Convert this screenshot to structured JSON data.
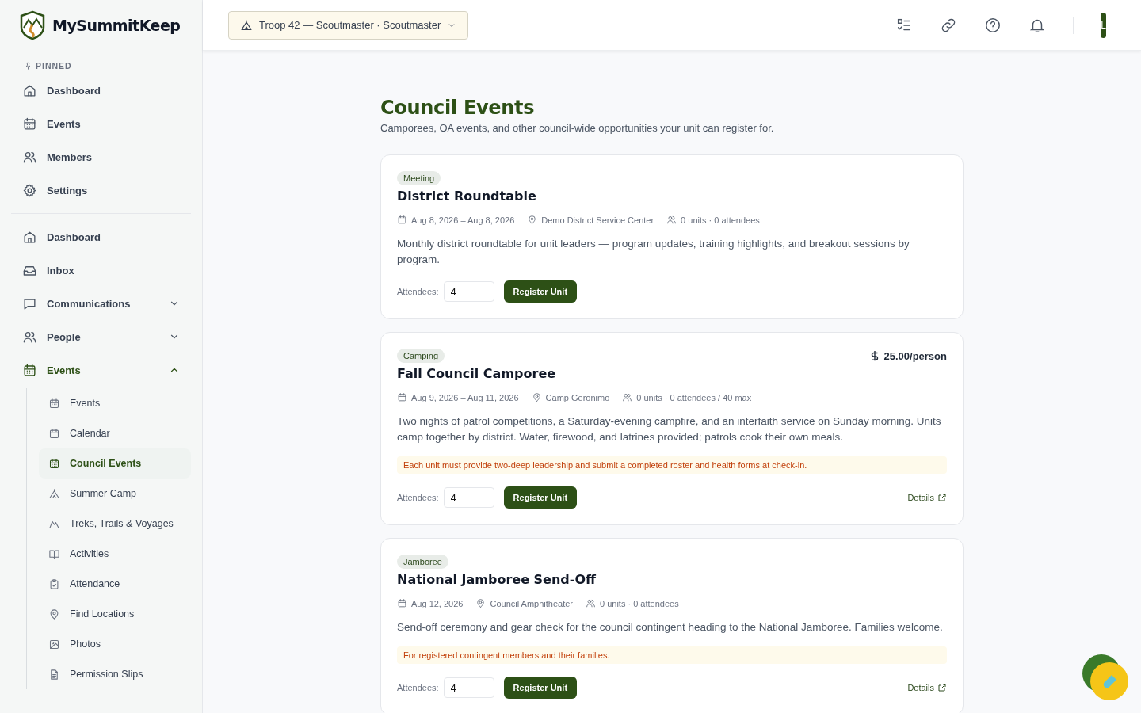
{
  "app": {
    "name": "MySummitKeep"
  },
  "unit_selector": {
    "label": "Troop 42 — Scoutmaster · Scoutmaster"
  },
  "account": {
    "initial": "L"
  },
  "sidebar": {
    "pinned_heading": "PINNED",
    "pinned": [
      {
        "label": "Dashboard",
        "kind": "home"
      },
      {
        "label": "Events",
        "kind": "calendar"
      },
      {
        "label": "Members",
        "kind": "people"
      },
      {
        "label": "Settings",
        "kind": "gear"
      }
    ],
    "nav": [
      {
        "label": "Dashboard",
        "kind": "home"
      },
      {
        "label": "Inbox",
        "kind": "inbox"
      },
      {
        "label": "Communications",
        "kind": "chat",
        "expanded": false
      },
      {
        "label": "People",
        "kind": "people",
        "expanded": false
      },
      {
        "label": "Events",
        "kind": "calendar",
        "expanded": true,
        "children": [
          {
            "label": "Events",
            "kind": "calendar",
            "selected": false
          },
          {
            "label": "Calendar",
            "kind": "calendar-blank",
            "selected": false
          },
          {
            "label": "Council Events",
            "kind": "calendar",
            "selected": true
          },
          {
            "label": "Summer Camp",
            "kind": "tent",
            "selected": false
          },
          {
            "label": "Treks, Trails & Voyages",
            "kind": "mountain",
            "selected": false
          },
          {
            "label": "Activities",
            "kind": "book",
            "selected": false
          },
          {
            "label": "Attendance",
            "kind": "clipboard",
            "selected": false
          },
          {
            "label": "Find Locations",
            "kind": "pin",
            "selected": false
          },
          {
            "label": "Photos",
            "kind": "image",
            "selected": false
          },
          {
            "label": "Permission Slips",
            "kind": "doc",
            "selected": false
          }
        ]
      }
    ]
  },
  "page": {
    "title": "Council Events",
    "subtitle": "Camporees, OA events, and other council-wide opportunities your unit can register for."
  },
  "events": [
    {
      "category": "Meeting",
      "title": "District Roundtable",
      "dates": "Aug 8, 2026 – Aug 8, 2026",
      "location": "Demo District Service Center",
      "stats": "0 units · 0 attendees",
      "description": "Monthly district roundtable for unit leaders — program updates, training highlights, and breakout sessions by program.",
      "attendees_label": "Attendees:",
      "attendees_value": "4",
      "register_label": "Register Unit"
    },
    {
      "category": "Camping",
      "title": "Fall Council Camporee",
      "price": "25.00/person",
      "dates": "Aug 9, 2026 – Aug 11, 2026",
      "location": "Camp Geronimo",
      "stats": "0 units · 0 attendees / 40 max",
      "description": "Two nights of patrol competitions, a Saturday-evening campfire, and an interfaith service on Sunday morning. Units camp together by district. Water, firewood, and latrines provided; patrols cook their own meals.",
      "note": "Each unit must provide two-deep leadership and submit a completed roster and health forms at check-in.",
      "attendees_label": "Attendees:",
      "attendees_value": "4",
      "register_label": "Register Unit",
      "details_label": "Details"
    },
    {
      "category": "Jamboree",
      "title": "National Jamboree Send-Off",
      "dates": "Aug 12, 2026",
      "location": "Council Amphitheater",
      "stats": "0 units · 0 attendees",
      "description": "Send-off ceremony and gear check for the council contingent heading to the National Jamboree. Families welcome.",
      "note": "For registered contingent members and their families.",
      "attendees_label": "Attendees:",
      "attendees_value": "4",
      "register_label": "Register Unit",
      "details_label": "Details"
    }
  ]
}
